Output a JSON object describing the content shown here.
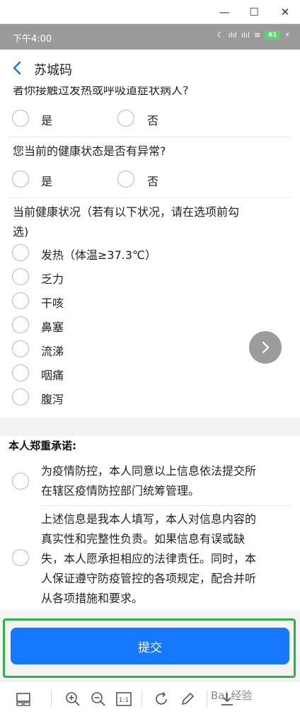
{
  "window": {
    "minimize": "—",
    "maximize": "☐",
    "close": "✕"
  },
  "status_bar": {
    "time": "下午4:00",
    "signal": "ılıl",
    "battery": "61",
    "accent_battery": "#58d36a"
  },
  "header": {
    "title": "苏城码"
  },
  "questions": [
    {
      "text": "者你接触过发热或呼吸道症状病人?",
      "options": [
        "是",
        "否"
      ]
    },
    {
      "text": "您当前的健康状态是否有异常?",
      "options": [
        "是",
        "否"
      ]
    },
    {
      "text_line1": "当前健康状况（若有以下状况，请在选项前勾",
      "text_line2": "选)",
      "options": [
        "发热（体温≥37.3℃）",
        "乏力",
        "干咳",
        "鼻塞",
        "流涕",
        "咽痛",
        "腹泻"
      ]
    }
  ],
  "pledge": {
    "title": "本人郑重承诺:",
    "items": [
      {
        "line1": "为疫情防控，本人同意以上信息依法提交所",
        "line2": "在辖区疫情防控部门统筹管理。"
      },
      {
        "line1": "上述信息是我本人填写，本人对信息内容的",
        "line2": "真实性和完整性负责。如果信息有误或缺",
        "line3": "失，本人愿承担相应的法律责任。同时，本",
        "line4": "人保证遵守防疫管控的各项规定，配合并听",
        "line5": "从各项措施和要求。"
      }
    ]
  },
  "submit": {
    "label": "提交",
    "color": "#1677ff",
    "highlight_color": "#2db24a"
  },
  "watermark": {
    "text": "Bai 经验"
  }
}
